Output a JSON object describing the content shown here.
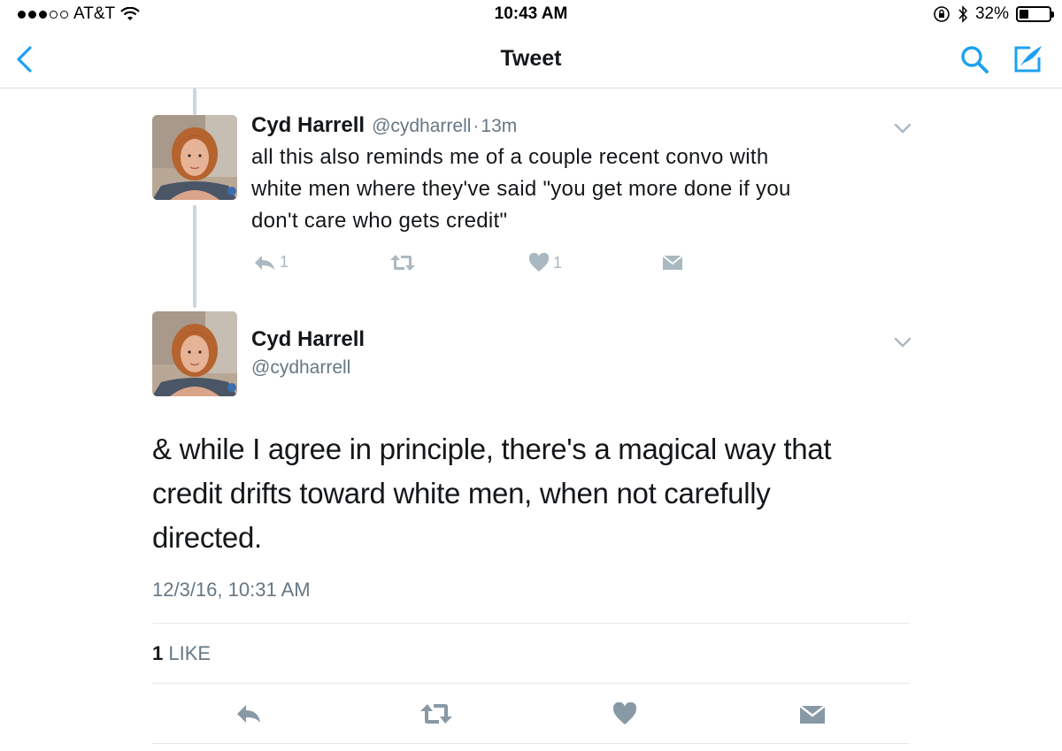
{
  "status_bar": {
    "carrier": "AT&T",
    "signal_filled": 3,
    "signal_total": 5,
    "time": "10:43 AM",
    "battery_percent": "32%",
    "battery_level": 0.32
  },
  "nav": {
    "title": "Tweet",
    "icons": [
      "back-chevron-icon",
      "search-icon",
      "compose-icon"
    ]
  },
  "parent_tweet": {
    "name": "Cyd Harrell",
    "handle": "@cydharrell",
    "separator": "·",
    "age": "13m",
    "text_lines": [
      "all this also reminds me of a couple recent convo with",
      "white men where they've said \"you get more done if you",
      "don't care who gets credit\""
    ],
    "reply_count": "1",
    "like_count": "1"
  },
  "main_tweet": {
    "name": "Cyd Harrell",
    "handle": "@cydharrell",
    "text_lines": [
      "& while I agree in principle, there's a magical way that",
      "credit drifts toward white men, when not carefully",
      "directed."
    ],
    "timestamp": "12/3/16, 10:31 AM",
    "likes_count": "1",
    "likes_label": "LIKE"
  },
  "colors": {
    "accent": "#1da1f2",
    "muted_icon": "#aab8c2",
    "bottom_icon": "#8899a6",
    "secondary_text": "#657786",
    "divider": "#e1e8ed"
  }
}
